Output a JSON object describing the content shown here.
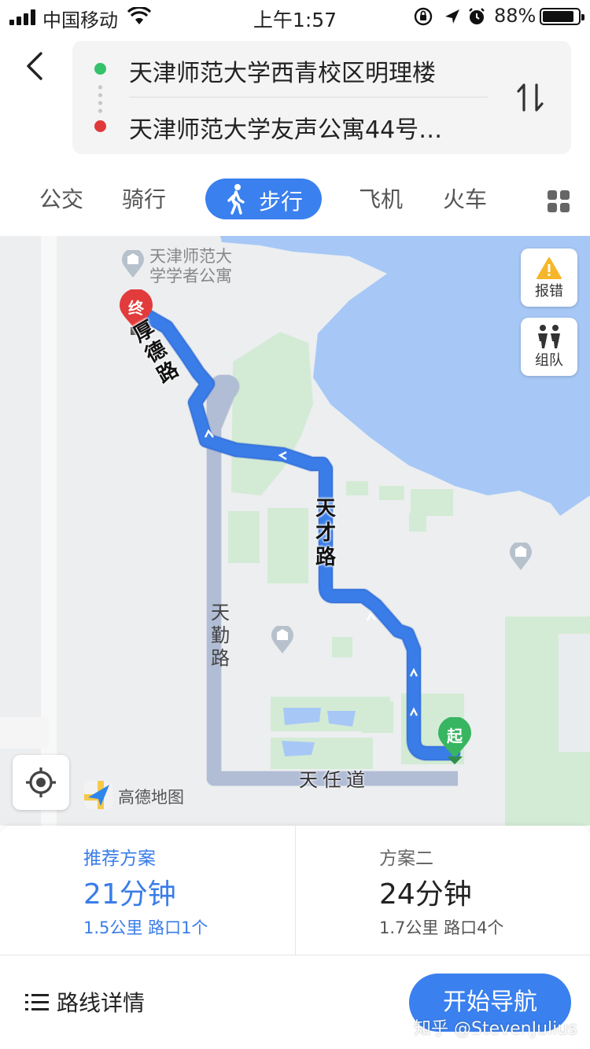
{
  "status_bar": {
    "carrier": "中国移动",
    "time": "上午1:57",
    "battery": "88%",
    "battery_level": 0.88,
    "icons": [
      "signal-icon",
      "wifi-icon",
      "orientation-lock-icon",
      "location-arrow-icon",
      "alarm-icon",
      "battery-icon"
    ]
  },
  "route": {
    "from": "天津师范大学西青校区明理楼",
    "to": "天津师范大学友声公寓44号…"
  },
  "tabs": {
    "bus": "公交",
    "bike": "骑行",
    "walk": "步行",
    "plane": "飞机",
    "train": "火车"
  },
  "map": {
    "poi_label": "天津师范大学学者公寓",
    "report_label": "报错",
    "team_label": "组队",
    "end_pin": "终",
    "start_pin": "起",
    "roads": {
      "houde": "厚德路",
      "tiancai": "天才路",
      "tianqin": "天勤路",
      "tianren": "天任道"
    },
    "logo": "高德地图",
    "colors": {
      "route": "#3a7de8",
      "water": "#a6c8f7",
      "green": "#d3ecd3",
      "alt_route": "#b8c3db"
    }
  },
  "plans": [
    {
      "title": "推荐方案",
      "time": "21分钟",
      "meta": "1.5公里 路口1个"
    },
    {
      "title": "方案二",
      "time": "24分钟",
      "meta": "1.7公里 路口4个"
    }
  ],
  "footer": {
    "details": "路线详情",
    "start_nav": "开始导航",
    "watermark": "知乎 @StevenJulius"
  }
}
